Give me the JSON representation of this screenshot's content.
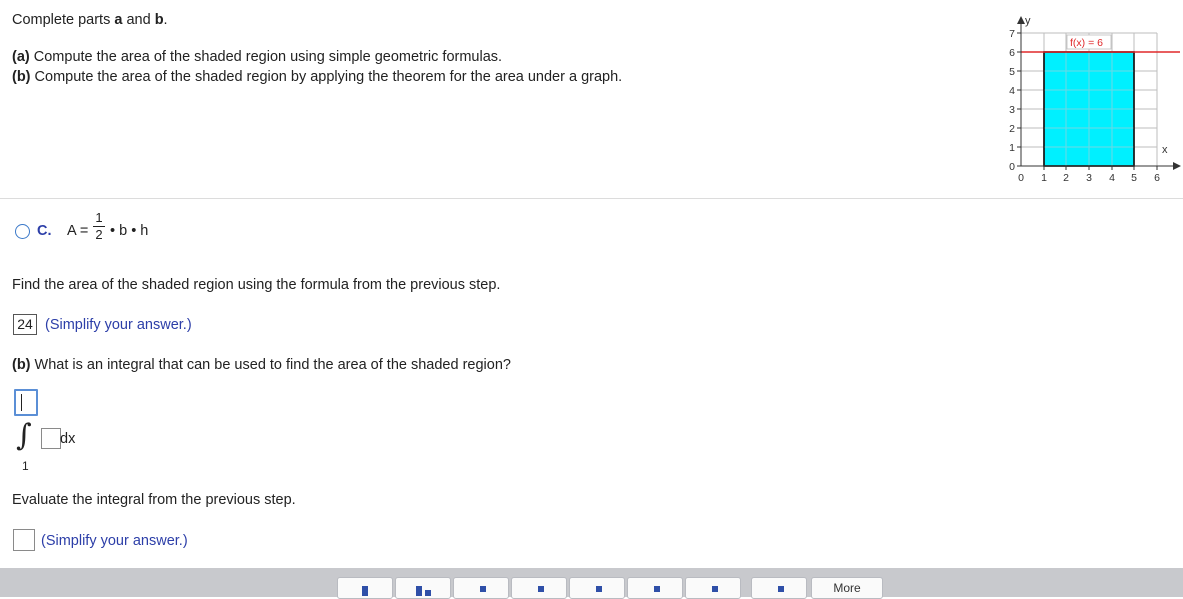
{
  "intro": {
    "prefix": "Complete parts ",
    "a": "a",
    "and": " and ",
    "b": "b",
    "period": "."
  },
  "parts": {
    "a_label": "(a)",
    "a_text": " Compute the area of the shaded region using simple geometric formulas.",
    "b_label": "(b)",
    "b_text": " Compute the area of the shaded region by applying the theorem for the area under a graph."
  },
  "graph": {
    "function_label": "f(x) = 6",
    "y_axis_label": "y",
    "x_axis_label": "x",
    "x_ticks": [
      "0",
      "1",
      "2",
      "3",
      "4",
      "5",
      "6"
    ],
    "y_ticks": [
      "0",
      "1",
      "2",
      "3",
      "4",
      "5",
      "6",
      "7"
    ],
    "shade_color": "#00f0ff",
    "line_color": "#e0282a"
  },
  "option_c": {
    "letter": "C.",
    "lhs": "A =",
    "numerator": "1",
    "denominator": "2",
    "rest": "• b • h"
  },
  "step1": {
    "instruction": "Find the area of the shaded region using the formula from the previous step.",
    "answer": "24",
    "hint": "(Simplify your answer.)"
  },
  "step2": {
    "label": "(b)",
    "question": " What is an integral that can be used to find the area of the shaded region?",
    "integral_sign": "∫",
    "dx": "dx",
    "lower_limit": "1"
  },
  "step3": {
    "instruction": "Evaluate the integral from the previous step.",
    "hint": "(Simplify your answer.)"
  },
  "toolbar": {
    "more_label": "More"
  }
}
